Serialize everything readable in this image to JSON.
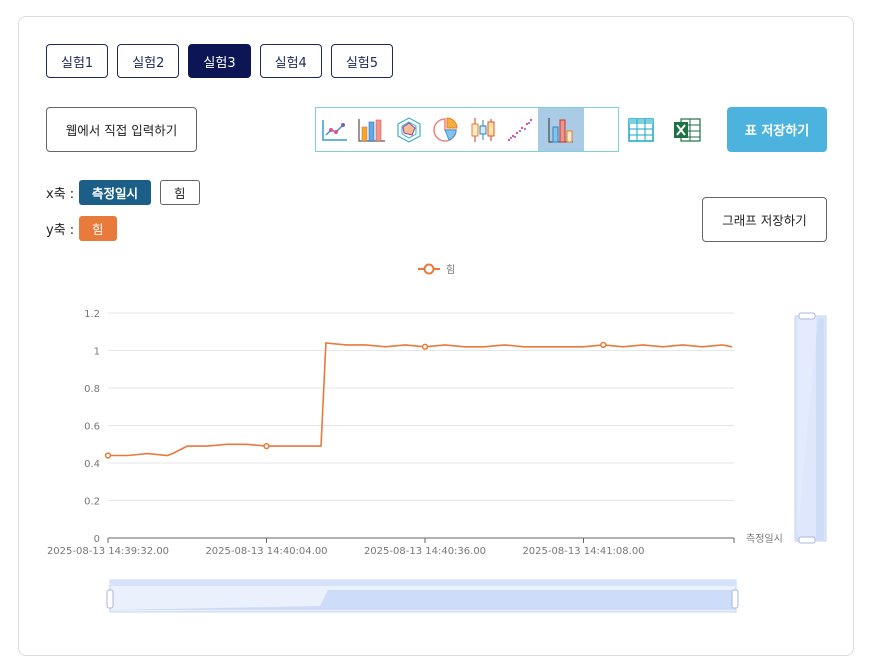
{
  "tabs": [
    {
      "label": "실험1",
      "active": false
    },
    {
      "label": "실험2",
      "active": false
    },
    {
      "label": "실험3",
      "active": true
    },
    {
      "label": "실험4",
      "active": false
    },
    {
      "label": "실험5",
      "active": false
    }
  ],
  "web_input_label": "웹에서 직접 입력하기",
  "toolbar_icons": [
    "line-chart-icon",
    "bar-chart-icon",
    "radar-chart-icon",
    "pie-chart-icon",
    "candlestick-chart-icon",
    "scatter-chart-icon",
    "column-chart-icon"
  ],
  "table_icon": "table-icon",
  "excel_icon": "excel-icon",
  "save_table_label": "표 저장하기",
  "save_graph_label": "그래프 저장하기",
  "x_axis": {
    "label": "x축 :",
    "options": [
      "측정일시",
      "힘"
    ],
    "selected": "측정일시"
  },
  "y_axis": {
    "label": "y축 :",
    "options": [
      "힘"
    ],
    "selected": "힘"
  },
  "colors": {
    "series": "#e87a3c",
    "nav": "#1e2a5a",
    "accent": "#4bb3dd",
    "x_selected": "#1b5f88"
  },
  "chart_data": {
    "type": "line",
    "legend": [
      "힘"
    ],
    "legend_position": "top-center",
    "xlabel": "측정일시",
    "ylim": [
      0,
      1.2
    ],
    "yticks": [
      "0",
      "0.2",
      "0.4",
      "0.6",
      "0.8",
      "1",
      "1.2"
    ],
    "xticks": [
      "2025-08-13 14:39:32.00",
      "2025-08-13 14:40:04.00",
      "2025-08-13 14:40:36.00",
      "2025-08-13 14:41:08.00"
    ],
    "grid": true,
    "zoom_sliders": [
      "x-bottom",
      "y-right"
    ],
    "series": [
      {
        "name": "힘",
        "x": [
          "2025-08-13 14:39:32.00",
          "2025-08-13 14:39:36.00",
          "2025-08-13 14:39:40.00",
          "2025-08-13 14:39:44.00",
          "2025-08-13 14:39:45.00",
          "2025-08-13 14:39:48.00",
          "2025-08-13 14:39:52.00",
          "2025-08-13 14:39:56.00",
          "2025-08-13 14:40:00.00",
          "2025-08-13 14:40:04.00",
          "2025-08-13 14:40:08.00",
          "2025-08-13 14:40:12.00",
          "2025-08-13 14:40:15.00",
          "2025-08-13 14:40:16.00",
          "2025-08-13 14:40:20.00",
          "2025-08-13 14:40:24.00",
          "2025-08-13 14:40:28.00",
          "2025-08-13 14:40:32.00",
          "2025-08-13 14:40:36.00",
          "2025-08-13 14:40:40.00",
          "2025-08-13 14:40:44.00",
          "2025-08-13 14:40:48.00",
          "2025-08-13 14:40:52.00",
          "2025-08-13 14:40:56.00",
          "2025-08-13 14:41:00.00",
          "2025-08-13 14:41:04.00",
          "2025-08-13 14:41:08.00",
          "2025-08-13 14:41:12.00",
          "2025-08-13 14:41:16.00",
          "2025-08-13 14:41:20.00",
          "2025-08-13 14:41:24.00",
          "2025-08-13 14:41:28.00",
          "2025-08-13 14:41:32.00",
          "2025-08-13 14:41:36.00",
          "2025-08-13 14:41:38.00"
        ],
        "y": [
          0.44,
          0.44,
          0.45,
          0.44,
          0.45,
          0.49,
          0.49,
          0.5,
          0.5,
          0.49,
          0.49,
          0.49,
          0.49,
          1.04,
          1.03,
          1.03,
          1.02,
          1.03,
          1.02,
          1.03,
          1.02,
          1.02,
          1.03,
          1.02,
          1.02,
          1.02,
          1.02,
          1.03,
          1.02,
          1.03,
          1.02,
          1.03,
          1.02,
          1.03,
          1.02
        ],
        "markers": [
          0,
          9,
          18,
          27
        ]
      }
    ]
  }
}
